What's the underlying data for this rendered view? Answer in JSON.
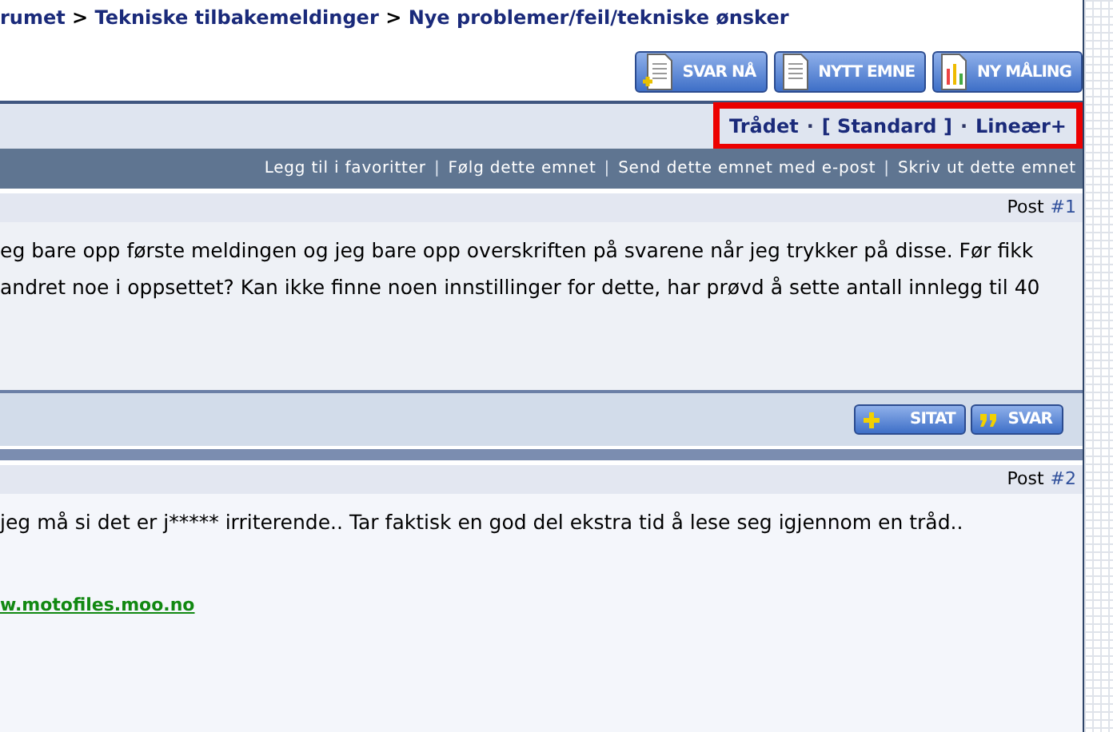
{
  "breadcrumb": [
    {
      "kind": "link",
      "text": "rumet"
    },
    {
      "kind": "separator",
      "text": ">"
    },
    {
      "kind": "link",
      "text": "Tekniske tilbakemeldinger"
    },
    {
      "kind": "separator",
      "text": ">"
    },
    {
      "kind": "link",
      "text": "Nye problemer/feil/tekniske ønsker"
    }
  ],
  "top_buttons": [
    {
      "label": "SVAR NÅ",
      "kind": "reply"
    },
    {
      "label": "NYTT EMNE",
      "kind": "new"
    },
    {
      "label": "NY MÅLING",
      "kind": "poll"
    }
  ],
  "display_modes": {
    "highlighted": true,
    "items": [
      {
        "kind": "link",
        "text": "Trådet"
      },
      {
        "kind": "separator",
        "text": "·"
      },
      {
        "kind": "link",
        "text": "[ Standard ]"
      },
      {
        "kind": "separator",
        "text": "·"
      },
      {
        "kind": "link",
        "text": "Lineær+"
      }
    ]
  },
  "thread_tools": [
    {
      "kind": "link",
      "text": "Legg til i favoritter"
    },
    {
      "kind": "separator",
      "text": "|"
    },
    {
      "kind": "link",
      "text": "Følg dette emnet"
    },
    {
      "kind": "separator",
      "text": "|"
    },
    {
      "kind": "link",
      "text": "Send dette emnet med e-post"
    },
    {
      "kind": "separator",
      "text": "|"
    },
    {
      "kind": "link",
      "text": "Skriv ut dette emnet"
    }
  ],
  "posts": [
    {
      "post_label": "Post",
      "post_number": "#1",
      "lines": [
        "eg bare opp første meldingen og jeg bare opp overskriften på svarene når jeg trykker på disse. Før fikk",
        "andret noe i oppsettet? Kan ikke finne noen innstillinger for dette, har prøvd å sette antall innlegg til 40"
      ],
      "footer_buttons": [
        {
          "label": "SITAT",
          "kind": "quote"
        },
        {
          "label": "SVAR",
          "kind": "reply"
        }
      ]
    },
    {
      "post_label": "Post",
      "post_number": "#2",
      "lines": [
        "jeg må si det er j***** irriterende.. Tar faktisk en god del ekstra tid å lese seg igjennom en tråd.."
      ],
      "signature_link": "w.motofiles.moo.no"
    }
  ]
}
